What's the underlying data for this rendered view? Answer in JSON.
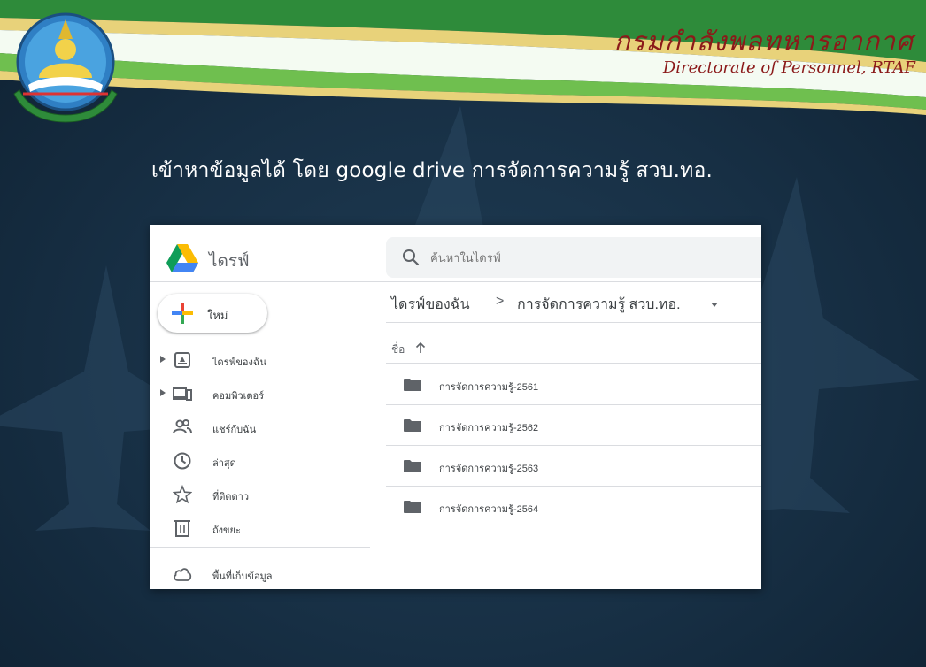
{
  "slide": {
    "org_name_th": "กรมกำลังพลทหารอากาศ",
    "org_name_en": "Directorate of Personnel, RTAF",
    "headline": "เข้าหาข้อมูลได้ โดย google drive การจัดการความรู้ สวบ.ทอ."
  },
  "drive": {
    "app_name": "ไดรฟ์",
    "search_placeholder": "ค้นหาในไดรฟ์",
    "new_button_label": "ใหม่",
    "nav_items": [
      {
        "label": "ไดรฟ์ของฉัน",
        "icon": "my-drive-icon",
        "expandable": true
      },
      {
        "label": "คอมพิวเตอร์",
        "icon": "computers-icon",
        "expandable": true
      },
      {
        "label": "แชร์กับฉัน",
        "icon": "shared-with-me-icon",
        "expandable": false
      },
      {
        "label": "ล่าสุด",
        "icon": "clock-icon",
        "expandable": false
      },
      {
        "label": "ที่ติดดาว",
        "icon": "star-icon",
        "expandable": false
      },
      {
        "label": "ถังขยะ",
        "icon": "trash-icon",
        "expandable": false
      },
      {
        "label": "พื้นที่เก็บข้อมูล",
        "icon": "cloud-icon",
        "expandable": false
      }
    ],
    "breadcrumb": [
      "ไดรฟ์ของฉัน",
      "การจัดการความรู้ สวบ.ทอ."
    ],
    "breadcrumb_separator": ">",
    "column_header": "ชื่อ",
    "sort_direction": "ascending",
    "files": [
      {
        "name": "การจัดการความรู้-2561",
        "type": "folder"
      },
      {
        "name": "การจัดการความรู้-2562",
        "type": "folder"
      },
      {
        "name": "การจัดการความรู้-2563",
        "type": "folder"
      },
      {
        "name": "การจัดการความรู้-2564",
        "type": "folder"
      }
    ]
  },
  "colors": {
    "background": "#172f44",
    "banner_green": "#2e8b3a",
    "banner_gold": "#e8d27a",
    "org_text": "#8b1a1a",
    "headline_text": "#ffffff"
  }
}
